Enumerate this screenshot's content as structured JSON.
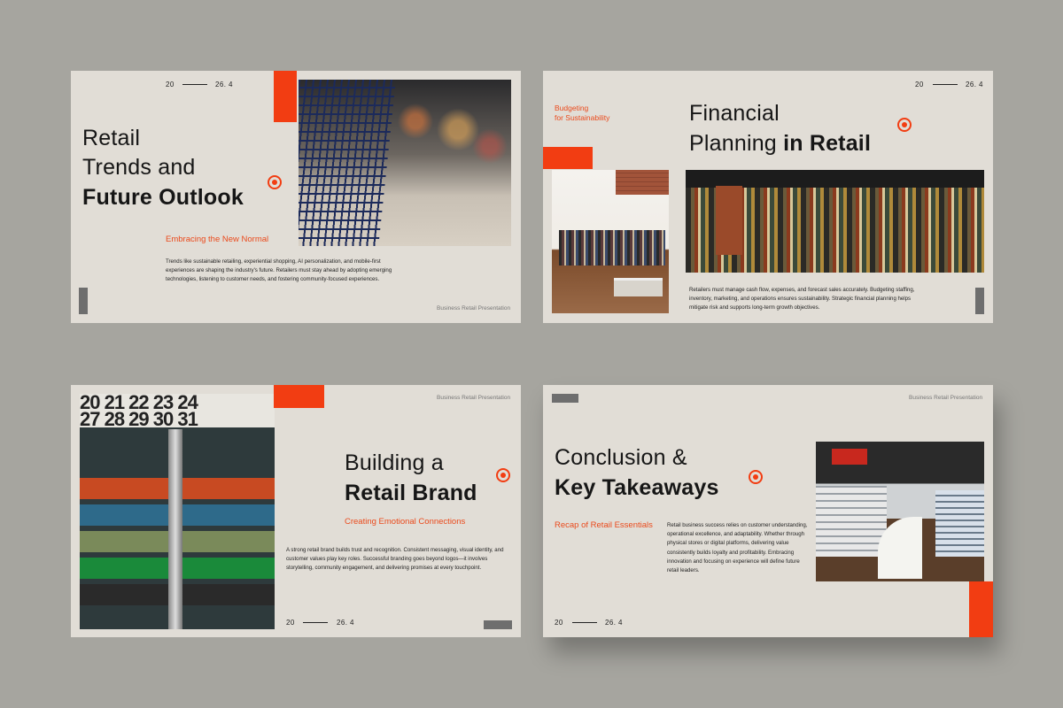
{
  "slides": {
    "s1": {
      "date_left": "20",
      "date_right": "26. 4",
      "title_line1": "Retail",
      "title_line2": "Trends and",
      "title_line3": "Future Outlook",
      "subtitle": "Embracing the New Normal",
      "body": "Trends like sustainable retailing, experiential shopping, AI personalization, and mobile-first experiences are shaping the industry's future. Retailers must stay ahead by adopting emerging technologies, listening to customer needs, and fostering community-focused experiences.",
      "footer": "Business Retail Presentation"
    },
    "s2": {
      "date_left": "20",
      "date_right": "26. 4",
      "tag_line1": "Budgeting",
      "tag_line2": "for Sustainability",
      "title_line1": "Financial",
      "title_line2_regular": "Planning",
      "title_line2_bold": "in Retail",
      "body": "Retailers must manage cash flow, expenses, and forecast sales accurately. Budgeting staffing, inventory, marketing, and operations ensures sustainability. Strategic financial planning helps mitigate risk and supports long-term growth objectives."
    },
    "s3": {
      "footer": "Business Retail Presentation",
      "calendar_numbers": "20 21 22 23 24\n27 28 29 30 31",
      "title_line1": "Building a",
      "title_line2": "Retail Brand",
      "subtitle": "Creating Emotional Connections",
      "body": "A strong retail brand builds trust and recognition. Consistent messaging, visual identity, and customer values play key roles. Successful branding goes beyond logos—it involves storytelling, community engagement, and delivering promises at every touchpoint.",
      "date_left": "20",
      "date_right": "26. 4"
    },
    "s4": {
      "footer": "Business Retail Presentation",
      "title_line1": "Conclusion &",
      "title_line2": "Key Takeaways",
      "subtitle": "Recap of Retail Essentials",
      "body": "Retail business success relies on customer understanding, operational excellence, and adaptability. Whether through physical stores or digital platforms, delivering value consistently builds loyalty and profitability. Embracing innovation and focusing on experience will define future retail leaders.",
      "date_left": "20",
      "date_right": "26. 4"
    }
  },
  "colors": {
    "accent": "#f23d12",
    "slide_bg": "#e1ddd6",
    "page_bg": "#a6a59f",
    "subtitle": "#ea4a1c"
  }
}
